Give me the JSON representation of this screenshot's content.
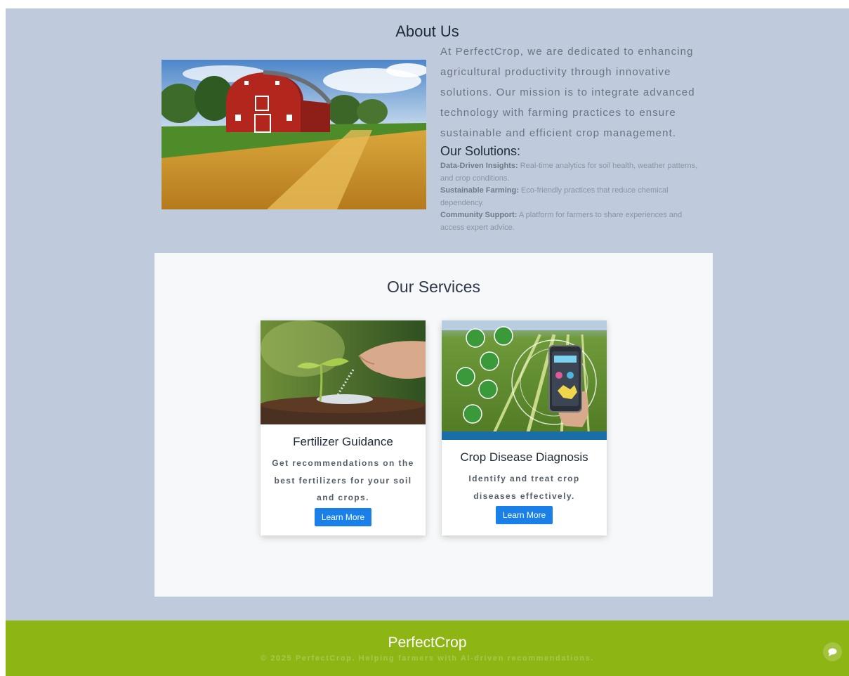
{
  "about": {
    "title": "About Us",
    "paragraph": "At PerfectCrop, we are dedicated to enhancing agricultural productivity through innovative solutions. Our mission is to integrate advanced technology with farming practices to ensure sustainable and efficient crop management.",
    "solutions_title": "Our Solutions:",
    "solutions": [
      {
        "label": "Data-Driven Insights:",
        "text": " Real-time analytics for soil health, weather patterns, and crop conditions."
      },
      {
        "label": "Sustainable Farming:",
        "text": " Eco-friendly practices that reduce chemical dependency."
      },
      {
        "label": "Community Support:",
        "text": " A platform for farmers to share experiences and access expert advice."
      }
    ]
  },
  "services": {
    "title": "Our Services",
    "cards": [
      {
        "title": "Fertilizer Guidance",
        "description": "Get recommendations on the best fertilizers for your soil and crops.",
        "button": "Learn More"
      },
      {
        "title": "Crop Disease Diagnosis",
        "description": "Identify and treat crop diseases effectively.",
        "button": "Learn More"
      }
    ]
  },
  "footer": {
    "brand": "PerfectCrop",
    "copyright": "© 2025 PerfectCrop. Helping farmers with AI-driven recommendations."
  },
  "colors": {
    "page_bg": "#bfcadc",
    "panel_bg": "#f6f8fa",
    "button_bg": "#1a7fe6",
    "footer_bg": "#8db514"
  },
  "icons": {
    "chat": "chat-bubble-icon"
  }
}
